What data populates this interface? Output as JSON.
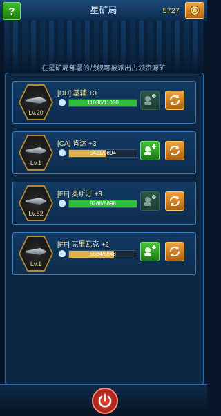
{
  "header": {
    "title": "星矿局",
    "help_label": "?",
    "currency": "5727",
    "currency_icon": "gold-coin-icon"
  },
  "banner": {
    "notice": "在星矿局部署的战舰可被派出占领资源矿"
  },
  "ships": [
    {
      "name": "[DD] 基辅 +3",
      "level": "Lv.20",
      "progress_text": "11030/11030",
      "progress_fraction": 1.0,
      "bar_color": "#2fbf3a",
      "add_enabled": false
    },
    {
      "name": "[CA] 肯达 +3",
      "level": "Lv.1",
      "progress_text": "5421/9894",
      "progress_fraction": 0.548,
      "bar_color": "#e0b04a",
      "add_enabled": true
    },
    {
      "name": "[FF] 奥斯汀 +3",
      "level": "Lv.82",
      "progress_text": "9288/8898",
      "progress_fraction": 1.0,
      "bar_color": "#2fbf3a",
      "add_enabled": false
    },
    {
      "name": "[FF] 克里瓦克 +2",
      "level": "Lv.1",
      "progress_text": "5884/8848",
      "progress_fraction": 0.665,
      "bar_color": "#e0b04a",
      "add_enabled": true
    }
  ],
  "footer": {
    "power_icon": "power-icon"
  }
}
